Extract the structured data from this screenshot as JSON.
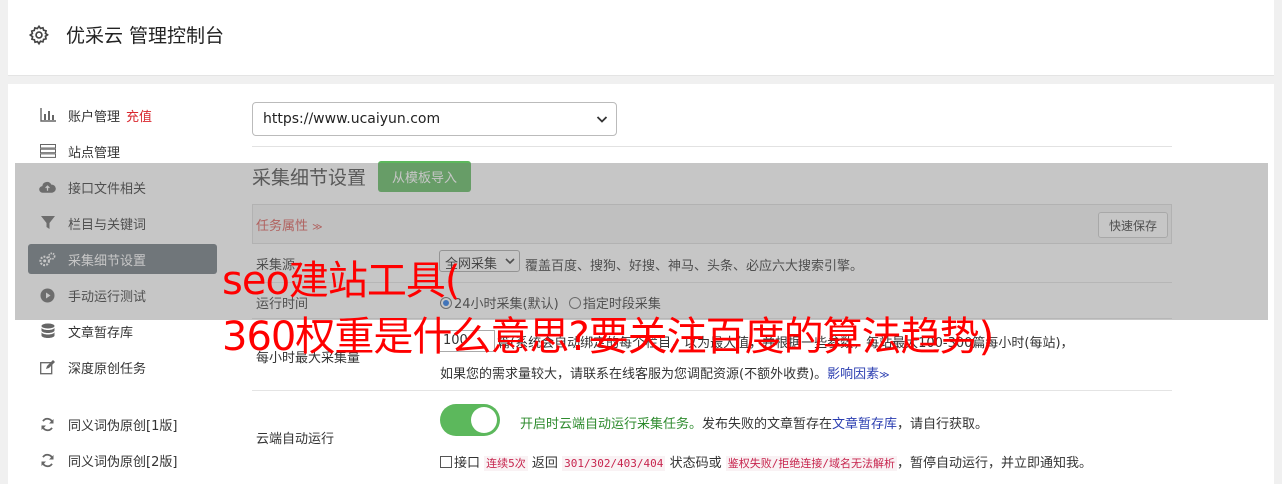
{
  "header": {
    "title": "优采云 管理控制台",
    "icon": "gear-icon"
  },
  "sidebar": {
    "items": [
      {
        "label": "账户管理",
        "badge": "充值",
        "icon": "bar-chart-icon"
      },
      {
        "label": "站点管理",
        "icon": "server-icon"
      },
      {
        "label": "接口文件相关",
        "icon": "cloud-upload-icon"
      },
      {
        "label": "栏目与关键词",
        "icon": "filter-icon"
      },
      {
        "label": "采集细节设置",
        "icon": "gears-icon",
        "active": true
      },
      {
        "label": "手动运行测试",
        "icon": "play-circle-icon"
      },
      {
        "label": "文章暂存库",
        "icon": "database-icon"
      },
      {
        "label": "深度原创任务",
        "icon": "edit-icon"
      },
      {
        "label": "同义词伪原创[1版]",
        "icon": "refresh-icon"
      },
      {
        "label": "同义词伪原创[2版]",
        "icon": "refresh-icon"
      }
    ]
  },
  "site_select": {
    "value": "https://www.ucaiyun.com"
  },
  "section": {
    "title": "采集细节设置",
    "import_button": "从模板导入"
  },
  "panel": {
    "task_attr": "任务属性",
    "quick_save": "快速保存"
  },
  "rows": {
    "source": {
      "label": "采集源",
      "select_value": "全网采集",
      "note": "覆盖百度、搜狗、好搜、神马、头条、必应六大搜索引擎。"
    },
    "run_time": {
      "label": "运行时间",
      "opt1": "24小时采集(默认)",
      "opt2": "指定时段采集"
    },
    "max_per_hour": {
      "label": "每小时最大采集量",
      "value": "100",
      "line1": "篇(系统会自动绑定的每个栏目，以为最大值，并根据一些参数，每站最大100-300篇每小时(每站)，",
      "line2": "如果您的需求量较大，请联系在线客服为您调配资源(不额外收费)。",
      "link": "影响因素"
    },
    "cloud_run": {
      "label": "云端自动运行",
      "on_text": "开启时云端自动运行采集任务。",
      "desc_a": "发布失败的文章暂存在",
      "desc_link": "文章暂存库",
      "desc_b": "，请自行获取。",
      "chk_a": "接口",
      "chk_code1": "连续5次",
      "chk_b": "返回",
      "chk_code2": "301/302/403/404",
      "chk_c": "状态码或",
      "chk_code3": "鉴权失败/拒绝连接/域名无法解析",
      "chk_d": "，暂停自动运行，并立即通知我。"
    }
  },
  "watermark": {
    "line1": "seo建站工具(",
    "line2": "360权重是什么意思?要关注百度的算法趋势)",
    "color": "#ff0000"
  }
}
